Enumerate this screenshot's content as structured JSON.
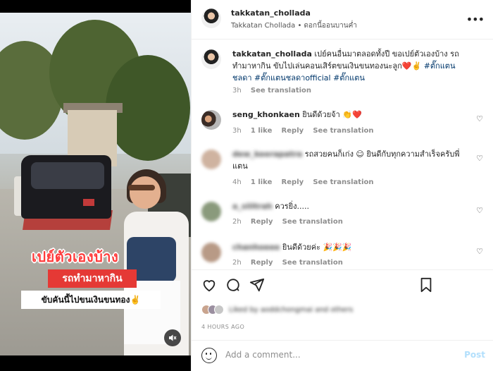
{
  "post": {
    "owner_username": "takkatan_chollada",
    "owner_subtitle": "Takkatan Chollada • ดอกนี้ออนบานค่ำ",
    "caption": {
      "username": "takkatan_chollada",
      "text": "เปย์คนอื่นมาตลอดทั้งปี ขอเปย์ตัวเองบ้าง รถทำมาหากิน ขับไปเล่นคอนเสิร์ตขนเงินขนทองนะลูก❤️✌️",
      "hashtags": "#ตั๊กแตนชลดา #ตั๊กแตนชลดาofficial #ตั๊กแตน",
      "time": "3h",
      "see_translation": "See translation"
    },
    "video_captions": {
      "line1": "เปย์ตัวเองบ้าง",
      "line2": "รถทำมาหากิน",
      "line3": "ขับคันนี้ไปขนเงินขนทอง✌️"
    }
  },
  "comments": [
    {
      "username": "seng_khonkaen",
      "text": "ยินดีด้วยจ้า 👏❤️",
      "time": "3h",
      "likes": "1 like",
      "reply": "Reply",
      "see_translation": "See translation",
      "blurred": false
    },
    {
      "username": "dew_keerapatra",
      "text": "รถสวยคนก็เก่ง ☺ ยินดีกับทุกความสำเร็จครับพี่แตน",
      "time": "4h",
      "likes": "1 like",
      "reply": "Reply",
      "see_translation": "See translation",
      "blurred": true
    },
    {
      "username": "a_siiitrah",
      "text": "ควรยิ่ง.....",
      "time": "2h",
      "likes": "",
      "reply": "Reply",
      "see_translation": "See translation",
      "blurred": true
    },
    {
      "username": "chanhoeee",
      "text": "ยินดีด้วยค่ะ 🎉🎉🎉",
      "time": "2h",
      "likes": "",
      "reply": "Reply",
      "see_translation": "See translation",
      "blurred": true
    }
  ],
  "actions": {
    "liked_by": "Liked by aoddchongmai and others",
    "timestamp": "4 HOURS AGO"
  },
  "add_comment": {
    "placeholder": "Add a comment...",
    "post_label": "Post"
  },
  "icons": [
    "more-icon",
    "heart-icon",
    "comment-icon",
    "share-icon",
    "save-icon",
    "emoji-icon",
    "mute-icon"
  ],
  "colors": {
    "link": "#00376b",
    "post_button_disabled": "#b2dffc",
    "caption_red": "#e53935"
  }
}
